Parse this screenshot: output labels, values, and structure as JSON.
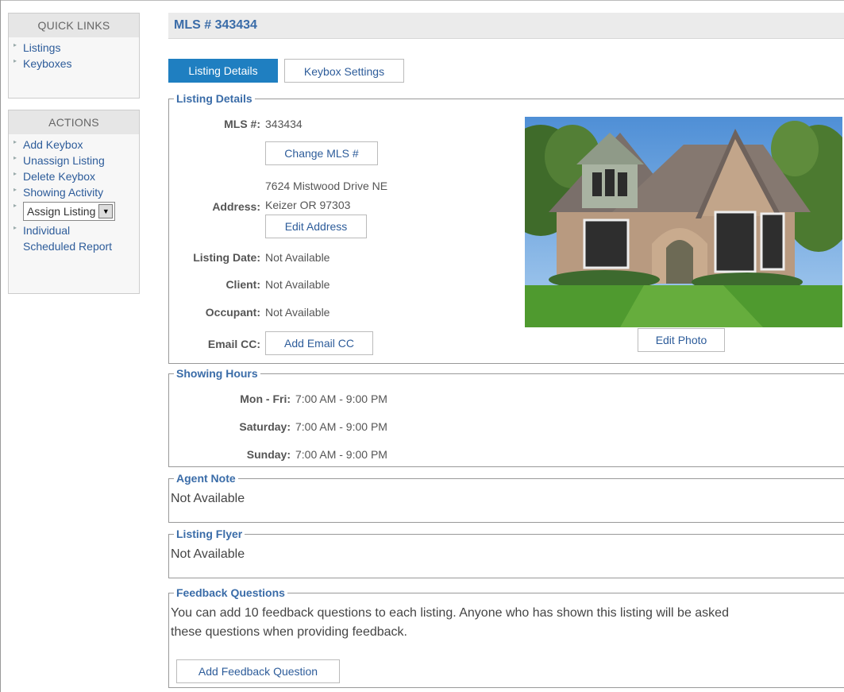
{
  "sidebar": {
    "quick_links": {
      "title": "QUICK LINKS",
      "items": [
        "Listings",
        "Keyboxes"
      ]
    },
    "actions": {
      "title": "ACTIONS",
      "items": [
        "Add Keybox",
        "Unassign Listing",
        "Delete Keybox",
        "Showing Activity"
      ],
      "assign_select_value": "Assign Listing",
      "report_line1": "Individual",
      "report_line2": "Scheduled Report"
    }
  },
  "header": {
    "title": "MLS # 343434"
  },
  "tabs": [
    {
      "label": "Listing Details",
      "active": true
    },
    {
      "label": "Keybox Settings",
      "active": false
    }
  ],
  "listing_details": {
    "legend": "Listing Details",
    "mls_label": "MLS #:",
    "mls_value": "343434",
    "change_mls_button": "Change MLS #",
    "address_label": "Address:",
    "address_line1": "7624 Mistwood Drive NE",
    "address_line2": "Keizer OR 97303",
    "edit_address_button": "Edit Address",
    "listing_date_label": "Listing Date:",
    "listing_date_value": "Not Available",
    "client_label": "Client:",
    "client_value": "Not Available",
    "occupant_label": "Occupant:",
    "occupant_value": "Not Available",
    "email_cc_label": "Email CC:",
    "add_email_cc_button": "Add Email CC",
    "edit_photo_button": "Edit Photo"
  },
  "showing_hours": {
    "legend": "Showing Hours",
    "rows": [
      {
        "day": "Mon - Fri:",
        "hours": "7:00 AM - 9:00 PM"
      },
      {
        "day": "Saturday:",
        "hours": "7:00 AM - 9:00 PM"
      },
      {
        "day": "Sunday:",
        "hours": "7:00 AM - 9:00 PM"
      }
    ]
  },
  "agent_note": {
    "legend": "Agent Note",
    "text": "Not Available"
  },
  "listing_flyer": {
    "legend": "Listing Flyer",
    "text": "Not Available"
  },
  "feedback": {
    "legend": "Feedback Questions",
    "line1": "You can add 10 feedback questions to each listing. Anyone who has shown this listing will be asked",
    "line2": "these questions when providing feedback.",
    "add_button": "Add Feedback Question"
  },
  "colors": {
    "link": "#2d5c9a",
    "heading": "#3a6ca8",
    "active_tab": "#1f7fc1"
  }
}
